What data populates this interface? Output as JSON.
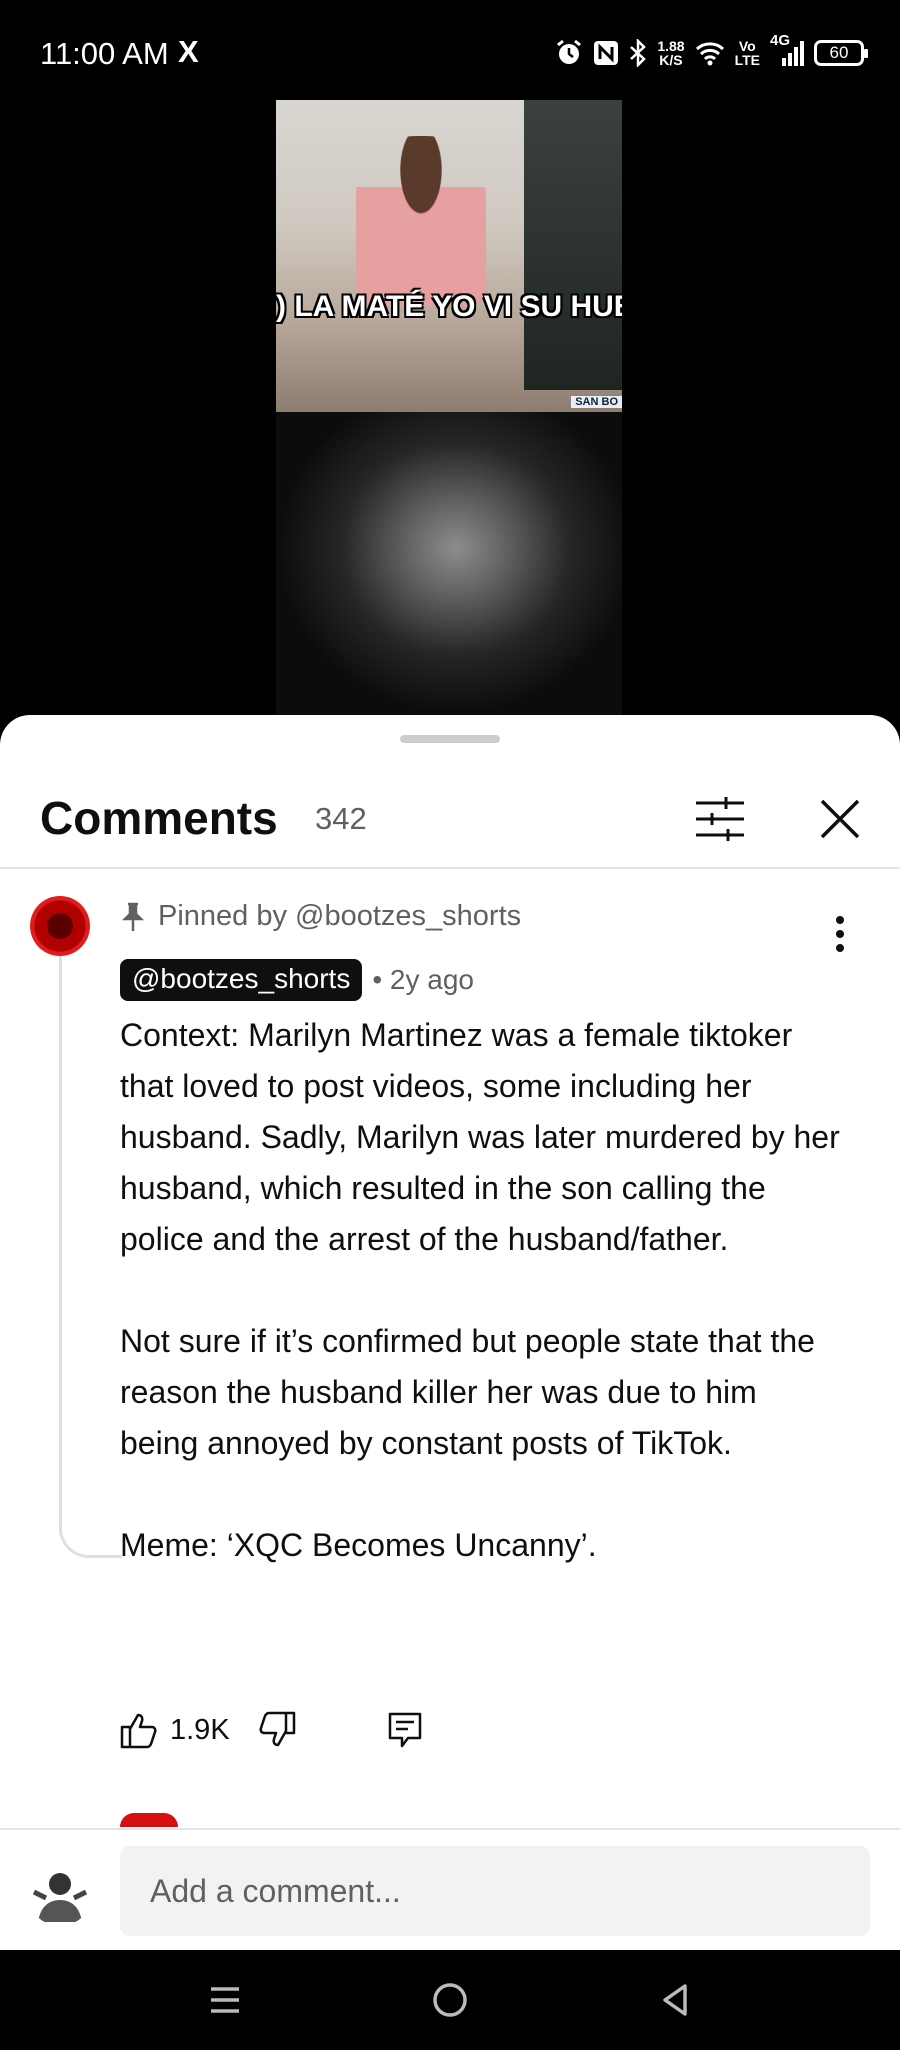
{
  "status_bar": {
    "time": "11:00 AM",
    "notification_icon": "X",
    "net_speed_value": "1.88",
    "net_speed_unit": "K/S",
    "volte_top": "Vo",
    "volte_bottom": "LTE",
    "network": "4G",
    "battery": "60"
  },
  "video": {
    "caption": ") LA MATÉ YO VI SU HUESO",
    "channel_watermark": "SAN BO"
  },
  "comments_sheet": {
    "title": "Comments",
    "count": "342"
  },
  "pinned_comment": {
    "pinned_label": "Pinned by @bootzes_shorts",
    "author": "@bootzes_shorts",
    "time": "• 2y ago",
    "paragraphs": [
      "Context: Marilyn Martinez was a female tiktoker that loved to post videos, some including her husband. Sadly, Marilyn was later murdered by her husband, which resulted in the son calling the police and the arrest of the husband/father.",
      "Not sure if it’s confirmed but people state that the reason the husband killer her was due to him being annoyed by constant posts of TikTok.",
      "Meme: ‘XQC Becomes Uncanny’."
    ],
    "like_count": "1.9K"
  },
  "composer": {
    "placeholder": "Add a comment..."
  },
  "colors": {
    "accent_dark": "#0f0f0f",
    "secondary_text": "#606060",
    "avatar_red": "#d61010"
  },
  "icons": [
    "x-logo-icon",
    "alarm-icon",
    "nfc-icon",
    "bluetooth-icon",
    "wifi-icon",
    "signal-icon",
    "battery-icon",
    "filter-icon",
    "close-icon",
    "pin-icon",
    "more-vert-icon",
    "thumb-up-icon",
    "thumb-down-icon",
    "reply-icon",
    "menu-icon",
    "home-icon",
    "back-icon"
  ]
}
